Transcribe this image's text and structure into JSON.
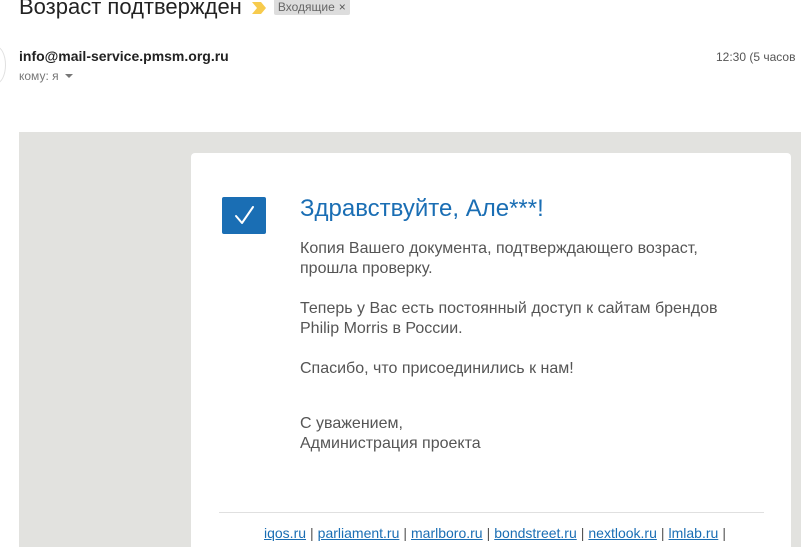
{
  "header": {
    "subject": "Возраст подтвержден",
    "label_chip": "Входящие",
    "label_remove": "×"
  },
  "message": {
    "sender": "info@mail-service.pmsm.org.ru",
    "recipient_line": "кому: я",
    "time": "12:30 (5 часов"
  },
  "email_body": {
    "greeting": "Здравствуйте, Але***!",
    "p1_line1": "Копия Вашего документа, подтверждающего возраст,",
    "p1_line2": "прошла проверку.",
    "p2_line1": "Теперь у Вас есть постоянный доступ к сайтам брендов",
    "p2_line2": "Philip Morris в России.",
    "p3": "Спасибо, что присоединились к нам!",
    "sign_line1": "С уважением,",
    "sign_line2": "Администрация проекта"
  },
  "footer": {
    "links": [
      "iqos.ru",
      "parliament.ru",
      "marlboro.ru",
      "bondstreet.ru",
      "nextlook.ru",
      "lmlab.ru"
    ],
    "separator": "|"
  },
  "colors": {
    "accent": "#1a6eb4",
    "important_marker": "#f7cb4d",
    "mail_background": "#e2e2df"
  },
  "icons": {
    "important": "important-marker-icon",
    "check": "checkmark-icon",
    "dropdown": "caret-down-icon"
  }
}
